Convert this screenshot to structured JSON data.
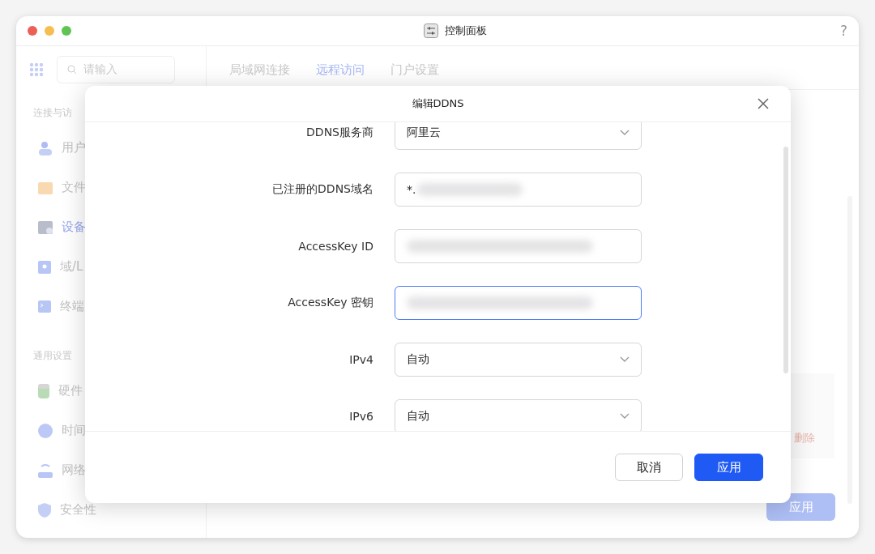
{
  "window": {
    "title": "控制面板",
    "help": "?"
  },
  "sidebar": {
    "search": {
      "placeholder": "请输入"
    },
    "sections": [
      {
        "title": "连接与访",
        "items": [
          {
            "label": "用户",
            "selected": false
          },
          {
            "label": "文件",
            "selected": false
          },
          {
            "label": "设备",
            "selected": true
          },
          {
            "label": "域/L",
            "selected": false
          },
          {
            "label": "终端",
            "selected": false
          }
        ]
      },
      {
        "title": "通用设置",
        "items": [
          {
            "label": "硬件",
            "selected": false
          },
          {
            "label": "时间",
            "selected": false
          },
          {
            "label": "网络",
            "selected": false
          },
          {
            "label": "安全性",
            "selected": false
          }
        ]
      }
    ]
  },
  "tabs": [
    {
      "label": "局域网连接",
      "selected": false
    },
    {
      "label": "远程访问",
      "selected": true
    },
    {
      "label": "门户设置",
      "selected": false
    }
  ],
  "background": {
    "delete_link": "删除",
    "apply_button": "应用"
  },
  "dialog": {
    "title": "编辑DDNS",
    "fields": [
      {
        "label": "DDNS服务商",
        "kind": "select",
        "value": "阿里云",
        "focused": false
      },
      {
        "label": "已注册的DDNS域名",
        "kind": "input",
        "value": "*.",
        "redacted": true,
        "focused": false
      },
      {
        "label": "AccessKey ID",
        "kind": "input",
        "redacted": true,
        "focused": false
      },
      {
        "label": "AccessKey 密钥",
        "kind": "input",
        "redacted": true,
        "focused": true
      },
      {
        "label": "IPv4",
        "kind": "select",
        "value": "自动",
        "focused": false
      },
      {
        "label": "IPv6",
        "kind": "select",
        "value": "自动",
        "focused": false
      }
    ],
    "buttons": [
      {
        "label": "取消",
        "kind": "secondary"
      },
      {
        "label": "应用",
        "kind": "primary"
      }
    ]
  }
}
